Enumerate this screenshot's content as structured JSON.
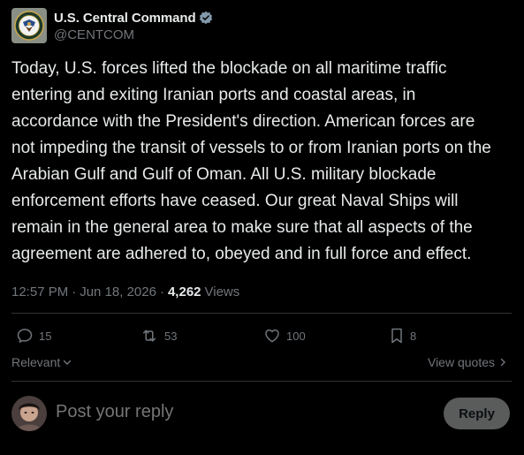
{
  "author": {
    "display_name": "U.S. Central Command",
    "handle": "@CENTCOM",
    "verified_icon": "verified-badge-icon"
  },
  "post": {
    "text": "Today, U.S. forces lifted the blockade on all maritime traffic\nentering and exiting Iranian ports and coastal areas, in\naccordance with the President's direction. American forces are\nnot impeding the transit of vessels to or from Iranian ports on the\nArabian Gulf and Gulf of Oman. All U.S. military blockade\nenforcement efforts have ceased. Our great Naval Ships will\nremain in the general area to make sure that all aspects of the\nagreement are adhered to, obeyed and in full force and effect.",
    "time": "12:57 PM",
    "separator": "·",
    "date": "Jun 18, 2026",
    "views_count": "4,262",
    "views_label": "Views"
  },
  "actions": {
    "replies": "15",
    "reposts": "53",
    "likes": "100",
    "bookmarks": "8"
  },
  "sort": {
    "relevant_label": "Relevant",
    "view_quotes_label": "View quotes"
  },
  "composer": {
    "placeholder": "Post your reply",
    "reply_button_label": "Reply"
  },
  "colors": {
    "background": "#000000",
    "text_primary": "#e7e9ea",
    "text_secondary": "#71767b",
    "divider": "#2f3336",
    "verified_badge": "#829aab",
    "reply_button_bg": "#787a7a"
  }
}
